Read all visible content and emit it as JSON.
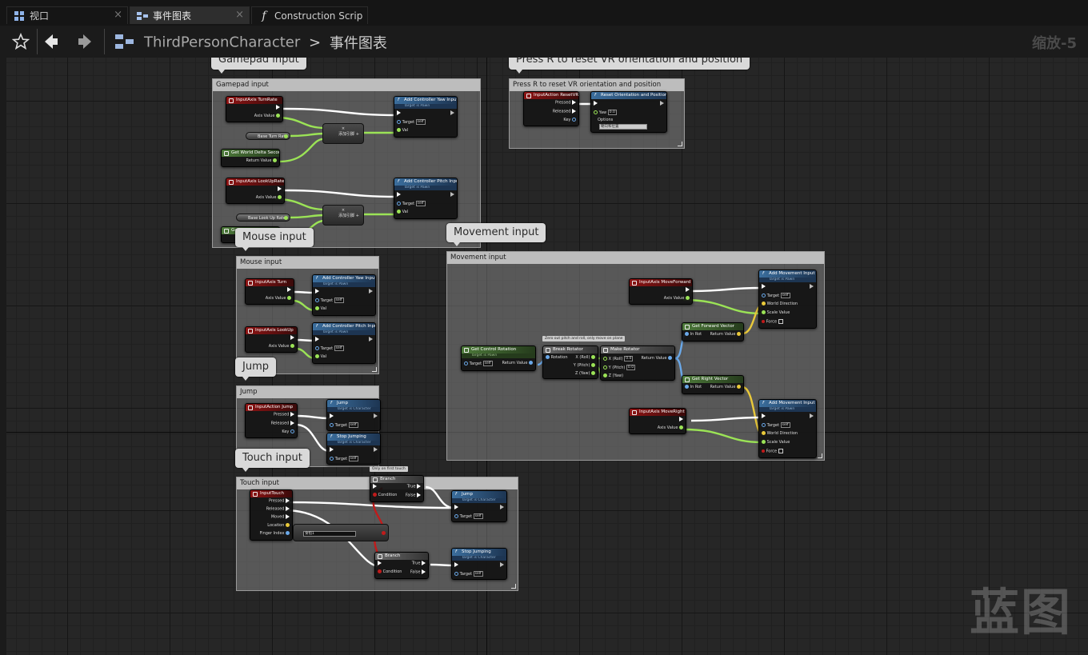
{
  "tabs": [
    {
      "label": "视口",
      "icon": "viewport-grid-icon"
    },
    {
      "label": "事件图表",
      "icon": "event-graph-icon"
    },
    {
      "label": "Construction Scrip",
      "icon": "function-icon"
    }
  ],
  "toolbar": {
    "breadcrumb_root": "ThirdPersonCharacter",
    "breadcrumb_sep": ">",
    "breadcrumb_leaf": "事件图表",
    "zoom": "缩放-5"
  },
  "watermark": "蓝图",
  "comments": {
    "gamepad": "Gamepad input",
    "vr": "Press R to reset VR orientation and position",
    "movement": "Movement input",
    "mouse": "Mouse input",
    "jump": "Jump",
    "touch": "Touch input"
  },
  "labels": {
    "axis_value": "Axis Value",
    "target": "Target",
    "self": "self",
    "val": "Val",
    "return_value": "Return Value",
    "pressed": "Pressed",
    "released": "Released",
    "key": "Key",
    "target_is_pawn": "Target is Pawn",
    "target_is_character": "Target is Character",
    "multiply": "×",
    "add_pin": "添加引脚 +",
    "true": "True",
    "false": "False",
    "condition": "Condition",
    "moved": "Moved",
    "location": "Location",
    "finger_index": "Finger Index",
    "yaw": "Yaw",
    "options": "Options",
    "rotation": "Rotation",
    "in_rot": "In Rot",
    "world_direction": "World Direction",
    "scale_value": "Scale Value",
    "force": "Force",
    "x_roll": "X (Roll)",
    "y_pitch": "Y (Pitch)",
    "z_yaw": "Z (Yaw)"
  },
  "nodes": {
    "turn_rate": "InputAxis TurnRate",
    "add_yaw": "Add Controller Yaw Input",
    "base_turn_rate": "Base Turn Rate",
    "world_delta": "Get World Delta Seconds",
    "lookup_rate": "InputAxis LookUpRate",
    "add_pitch": "Add Controller Pitch Input",
    "base_lookup_rate": "Base Look Up Rate",
    "turn": "InputAxis Turn",
    "lookup": "InputAxis LookUp",
    "jump_event": "InputAction Jump",
    "jump": "Jump",
    "stop_jumping": "Stop Jumping",
    "input_touch": "InputTouch",
    "only_first_touch": "Only on first touch",
    "branch": "Branch",
    "finger_select": "食指1",
    "reset_vr_event": "InputAction ResetVR",
    "reset_orientation": "Reset Orientation and Position",
    "yaw_value": "0.0",
    "options_value": "朝向和位置",
    "move_forward": "InputAxis MoveForward",
    "add_movement": "Add Movement Input",
    "get_forward": "Get Forward Vector",
    "get_control_rotation": "Get Control Rotation",
    "zero_comment": "Zero out pitch and roll, only move on plane",
    "break_rotator": "Break Rotator",
    "make_rotator": "Make Rotator",
    "zero": "0.0",
    "get_right": "Get Right Vector",
    "move_right": "InputAxis MoveRight"
  }
}
